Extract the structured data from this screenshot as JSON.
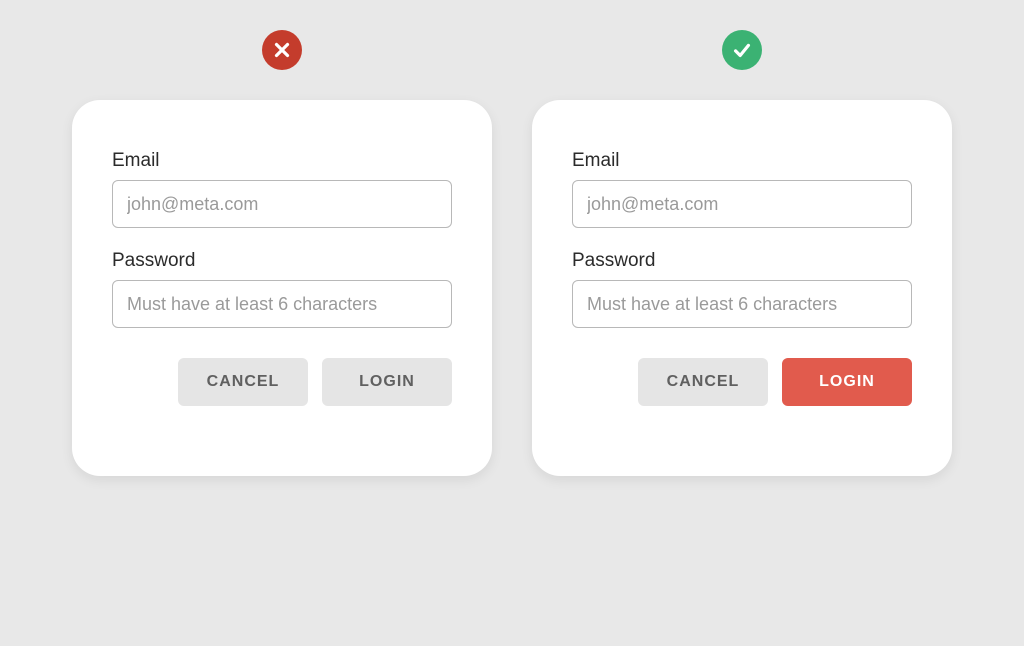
{
  "bad": {
    "email_label": "Email",
    "email_placeholder": "john@meta.com",
    "password_label": "Password",
    "password_placeholder": "Must have at least 6 characters",
    "cancel_label": "CANCEL",
    "login_label": "LOGIN"
  },
  "good": {
    "email_label": "Email",
    "email_placeholder": "john@meta.com",
    "password_label": "Password",
    "password_placeholder": "Must have at least 6 characters",
    "cancel_label": "CANCEL",
    "login_label": "LOGIN"
  }
}
